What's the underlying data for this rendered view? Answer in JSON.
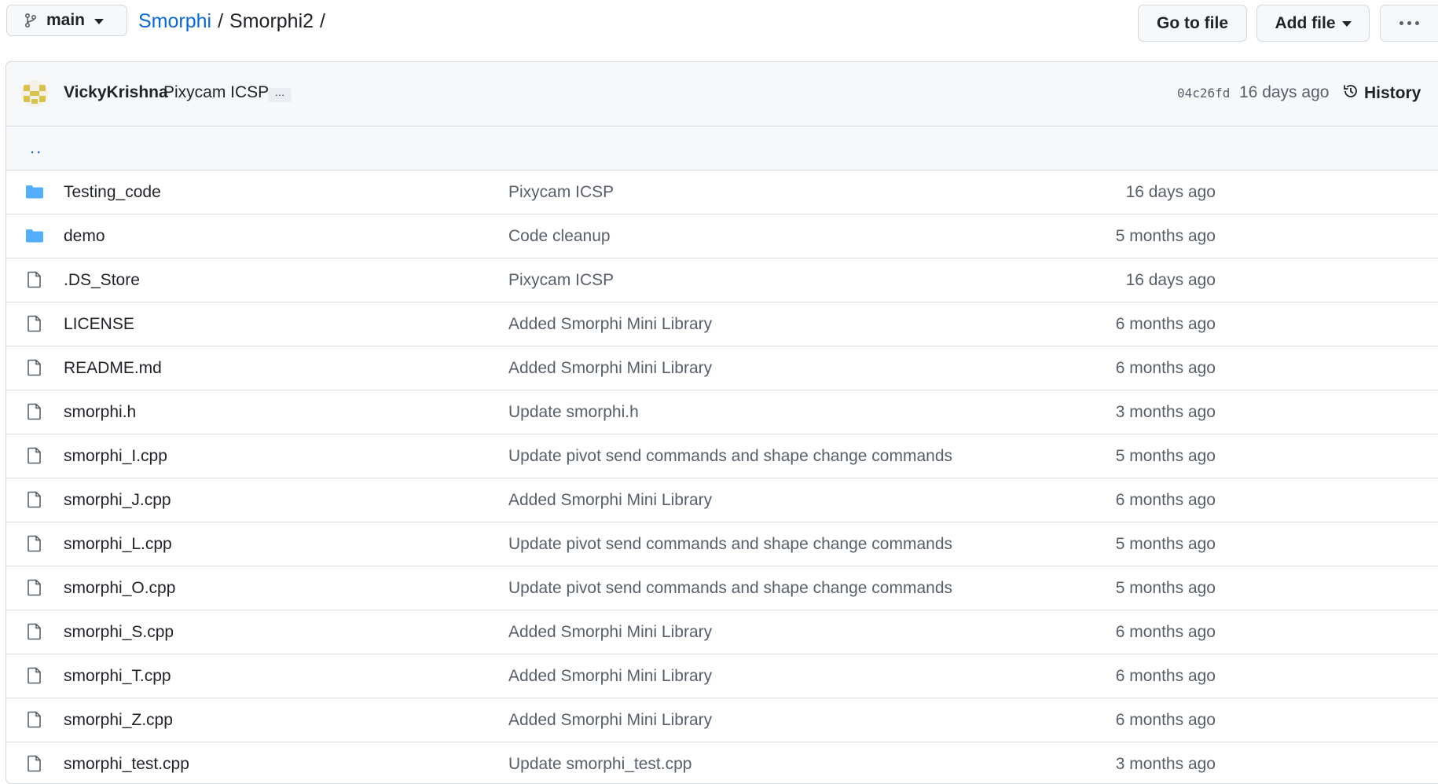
{
  "branch": {
    "name": "main"
  },
  "breadcrumb": {
    "repo": "Smorphi",
    "separator": "/",
    "path": "Smorphi2",
    "trailing": "/"
  },
  "actions": {
    "go_to_file": "Go to file",
    "add_file": "Add file"
  },
  "commit": {
    "author": "VickyKrishna",
    "message": "Pixycam ICSP",
    "expand": "…",
    "sha": "04c26fd",
    "age": "16 days ago",
    "history_label": "History"
  },
  "parent_link": "..",
  "colors": {
    "link": "#0969da",
    "folder": "#54aeff",
    "muted": "#57606a"
  },
  "files": [
    {
      "type": "folder",
      "name": "Testing_code",
      "message": "Pixycam ICSP",
      "age": "16 days ago"
    },
    {
      "type": "folder",
      "name": "demo",
      "message": "Code cleanup",
      "age": "5 months ago"
    },
    {
      "type": "file",
      "name": ".DS_Store",
      "message": "Pixycam ICSP",
      "age": "16 days ago"
    },
    {
      "type": "file",
      "name": "LICENSE",
      "message": "Added Smorphi Mini Library",
      "age": "6 months ago"
    },
    {
      "type": "file",
      "name": "README.md",
      "message": "Added Smorphi Mini Library",
      "age": "6 months ago"
    },
    {
      "type": "file",
      "name": "smorphi.h",
      "message": "Update smorphi.h",
      "age": "3 months ago"
    },
    {
      "type": "file",
      "name": "smorphi_I.cpp",
      "message": "Update pivot send commands and shape change commands",
      "age": "5 months ago"
    },
    {
      "type": "file",
      "name": "smorphi_J.cpp",
      "message": "Added Smorphi Mini Library",
      "age": "6 months ago"
    },
    {
      "type": "file",
      "name": "smorphi_L.cpp",
      "message": "Update pivot send commands and shape change commands",
      "age": "5 months ago"
    },
    {
      "type": "file",
      "name": "smorphi_O.cpp",
      "message": "Update pivot send commands and shape change commands",
      "age": "5 months ago"
    },
    {
      "type": "file",
      "name": "smorphi_S.cpp",
      "message": "Added Smorphi Mini Library",
      "age": "6 months ago"
    },
    {
      "type": "file",
      "name": "smorphi_T.cpp",
      "message": "Added Smorphi Mini Library",
      "age": "6 months ago"
    },
    {
      "type": "file",
      "name": "smorphi_Z.cpp",
      "message": "Added Smorphi Mini Library",
      "age": "6 months ago"
    },
    {
      "type": "file",
      "name": "smorphi_test.cpp",
      "message": "Update smorphi_test.cpp",
      "age": "3 months ago"
    }
  ]
}
